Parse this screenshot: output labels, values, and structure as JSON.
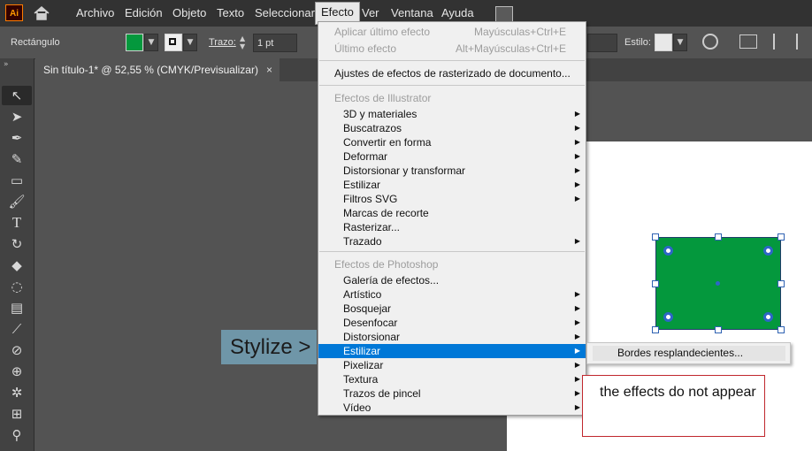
{
  "app": {
    "logo_text": "Ai"
  },
  "menubar": {
    "items": [
      "Archivo",
      "Edición",
      "Objeto",
      "Texto",
      "Seleccionar",
      "Efecto",
      "Ver",
      "Ventana",
      "Ayuda"
    ],
    "active": "Efecto"
  },
  "controlbar": {
    "tool_name": "Rectángulo",
    "fill_color": "#04983d",
    "stroke_label": "Trazo:",
    "stroke_value": "1 pt",
    "style_label": "Estilo:"
  },
  "document_tab": {
    "title": "Sin título-1* @ 52,55 % (CMYK/Previsualizar)",
    "close": "×"
  },
  "effect_menu": {
    "apply_last": {
      "label": "Aplicar último efecto",
      "shortcut": "Mayúsculas+Ctrl+E"
    },
    "last_effect": {
      "label": "Último efecto",
      "shortcut": "Alt+Mayúsculas+Ctrl+E"
    },
    "raster_settings": "Ajustes de efectos de rasterizado de documento...",
    "illustrator_header": "Efectos de Illustrator",
    "illustrator_items": [
      "3D y materiales",
      "Buscatrazos",
      "Convertir en forma",
      "Deformar",
      "Distorsionar y transformar",
      "Estilizar",
      "Filtros SVG",
      "Marcas de recorte",
      "Rasterizar...",
      "Trazado"
    ],
    "photoshop_header": "Efectos de Photoshop",
    "photoshop_items": [
      "Galería de efectos...",
      "Artístico",
      "Bosquejar",
      "Desenfocar",
      "Distorsionar",
      "Estilizar",
      "Pixelizar",
      "Textura",
      "Trazos de pincel",
      "Vídeo"
    ],
    "highlighted": "Estilizar"
  },
  "submenu": {
    "items": [
      "Bordes resplandecientes..."
    ]
  },
  "annotations": {
    "callout": "Stylize >",
    "note": "the effects do not appear"
  },
  "colors": {
    "accent": "#0078d7",
    "shape_fill": "#04983d",
    "note_border": "#c0272d",
    "callout_bg": "#6f96a8"
  },
  "toolbar": {
    "tools": [
      "selection-tool",
      "direct-selection-tool",
      "pen-tool",
      "curvature-tool",
      "rectangle-tool",
      "paintbrush-tool",
      "type-tool",
      "rotate-tool",
      "eraser-tool",
      "lasso-tool",
      "gradient-tool",
      "eyedropper-tool",
      "blend-tool",
      "shape-builder-tool",
      "symbol-sprayer-tool",
      "artboard-tool",
      "zoom-tool"
    ]
  }
}
